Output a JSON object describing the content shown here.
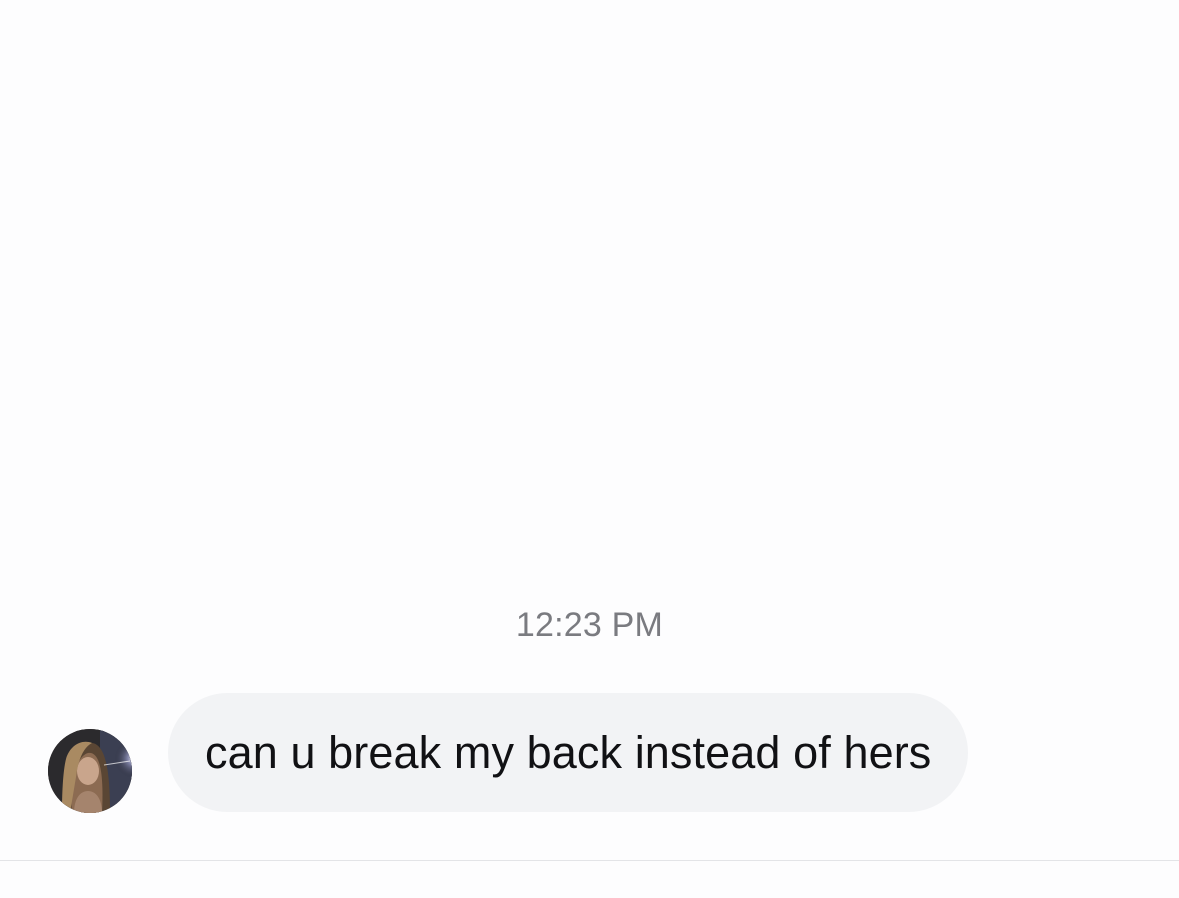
{
  "conversation": {
    "timestamp": "12:23 PM",
    "messages": [
      {
        "sender": "other",
        "text": "can u break my back instead of hers",
        "avatar_icon": "user-avatar-photo"
      }
    ]
  },
  "colors": {
    "background": "#fdfdfe",
    "bubble": "#f2f3f5",
    "message_text": "#111114",
    "timestamp_text": "#7a7b80",
    "divider": "#e3e4e7"
  }
}
